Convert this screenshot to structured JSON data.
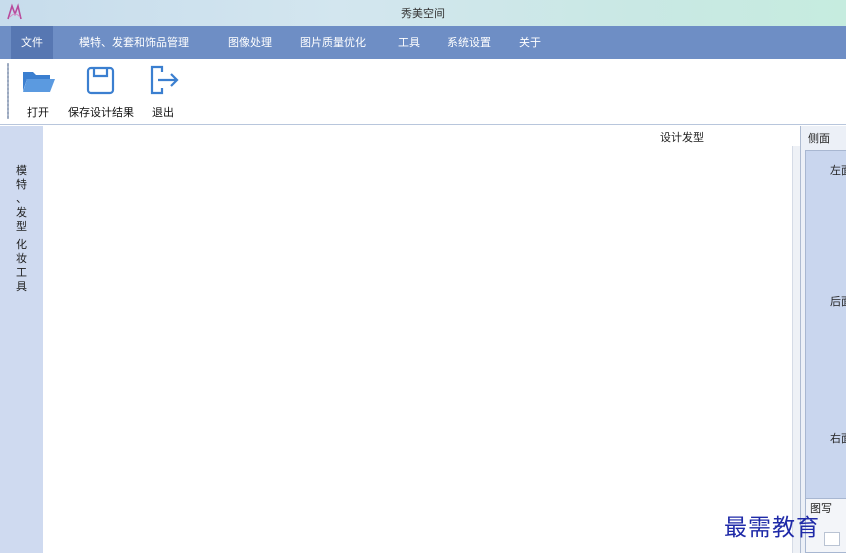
{
  "window": {
    "title": "秀美空间",
    "logo_icon": "app-logo-icon"
  },
  "menu": {
    "items": [
      {
        "label": "文件",
        "active": true
      },
      {
        "label": "模特、发套和饰品管理"
      },
      {
        "label": "图像处理"
      },
      {
        "label": "图片质量优化"
      },
      {
        "label": "工具"
      },
      {
        "label": "系统设置"
      },
      {
        "label": "关于"
      }
    ]
  },
  "toolbar": {
    "open": {
      "label": "打开",
      "icon": "folder-open-icon"
    },
    "save": {
      "label": "保存设计结果",
      "icon": "save-icon"
    },
    "exit": {
      "label": "退出",
      "icon": "exit-icon"
    }
  },
  "left_strip": {
    "tab_chars": [
      "模",
      "特",
      "、",
      "发",
      "型",
      "",
      "化",
      "妆",
      "工",
      "具"
    ]
  },
  "canvas": {
    "title": "设计发型"
  },
  "right_panel": {
    "header": "侧面",
    "labels": [
      "左面",
      "后面",
      "右面"
    ],
    "box2_title": "图写"
  },
  "watermark": "最需教育",
  "colors": {
    "menubar": "#6e8ec5",
    "menu_active": "#5777b2",
    "accent_icon": "#3b7fd0",
    "left_strip": "#cfdaf0",
    "watermark": "#1f2aa8"
  }
}
